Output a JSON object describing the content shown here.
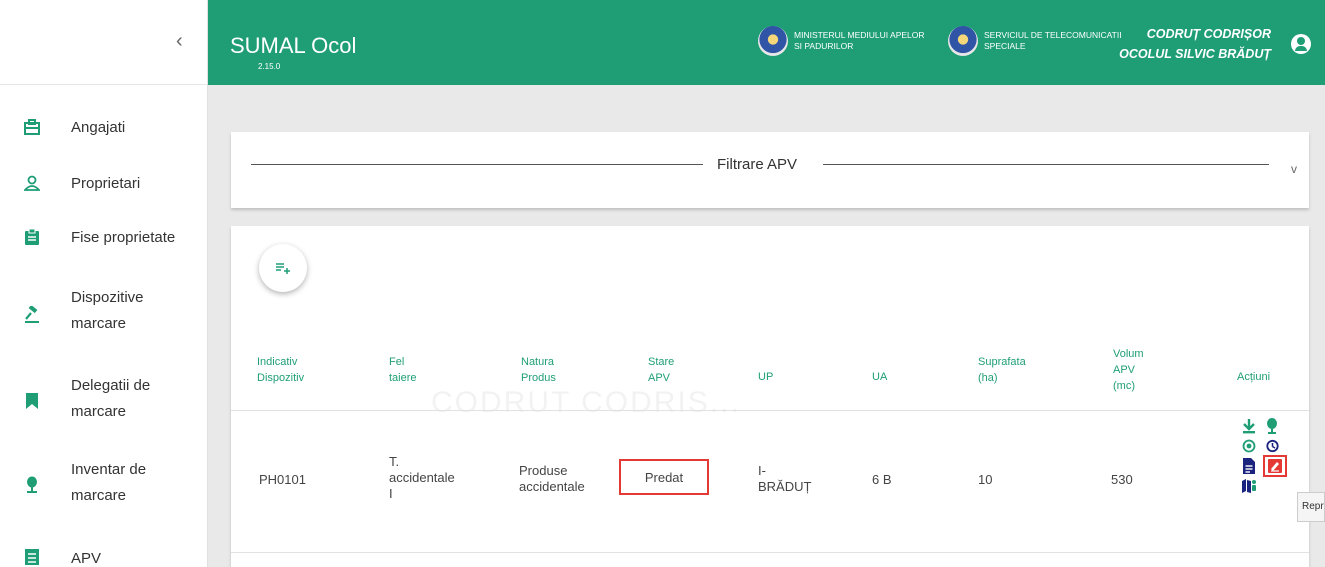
{
  "app": {
    "title": "SUMAL Ocol",
    "version": "2.15.0"
  },
  "header": {
    "org1": "MINISTERUL MEDIULUI APELOR SI PADURILOR",
    "org2": "SERVICIUL DE TELECOMUNICATII SPECIALE",
    "user_name": "CODRUȚ CODRIȘOR",
    "user_unit": "OCOLUL SILVIC BRĂDUȚ"
  },
  "sidebar": {
    "items": [
      {
        "label": "Angajati",
        "icon": "briefcase-icon"
      },
      {
        "label": "Proprietari",
        "icon": "person-icon"
      },
      {
        "label": "Fise proprietate",
        "icon": "clipboard-icon"
      },
      {
        "label": "Dispozitive marcare",
        "icon": "gavel-icon"
      },
      {
        "label": "Delegatii de marcare",
        "icon": "bookmark-icon"
      },
      {
        "label": "Inventar de marcare",
        "icon": "pin-icon"
      },
      {
        "label": "APV",
        "icon": "list-icon"
      }
    ],
    "collapse_glyph": "‹"
  },
  "filter": {
    "title": "Filtrare APV",
    "chevron": "v"
  },
  "table": {
    "columns": {
      "indicativ": "Indicativ Dispozitiv",
      "fel": "Fel taiere",
      "natura": "Natura Produs",
      "stare": "Stare APV",
      "up": "UP",
      "ua": "UA",
      "suprafata": "Suprafata (ha)",
      "volum": "Volum APV (mc)",
      "actiuni": "Acțiuni"
    },
    "row": {
      "indicativ": "PH0101",
      "fel": "T. accidentale I",
      "natura": "Produse accidentale",
      "stare": "Predat",
      "up": "I-BRĂDUȚ",
      "ua": "6 B",
      "suprafata": "10",
      "volum": "530"
    },
    "watermark": "CODRUT CODRIS..."
  },
  "tooltip": "Reprimire",
  "colors": {
    "primary": "#1f9e76",
    "highlight": "#e53935",
    "action_dark": "#1a237e"
  }
}
